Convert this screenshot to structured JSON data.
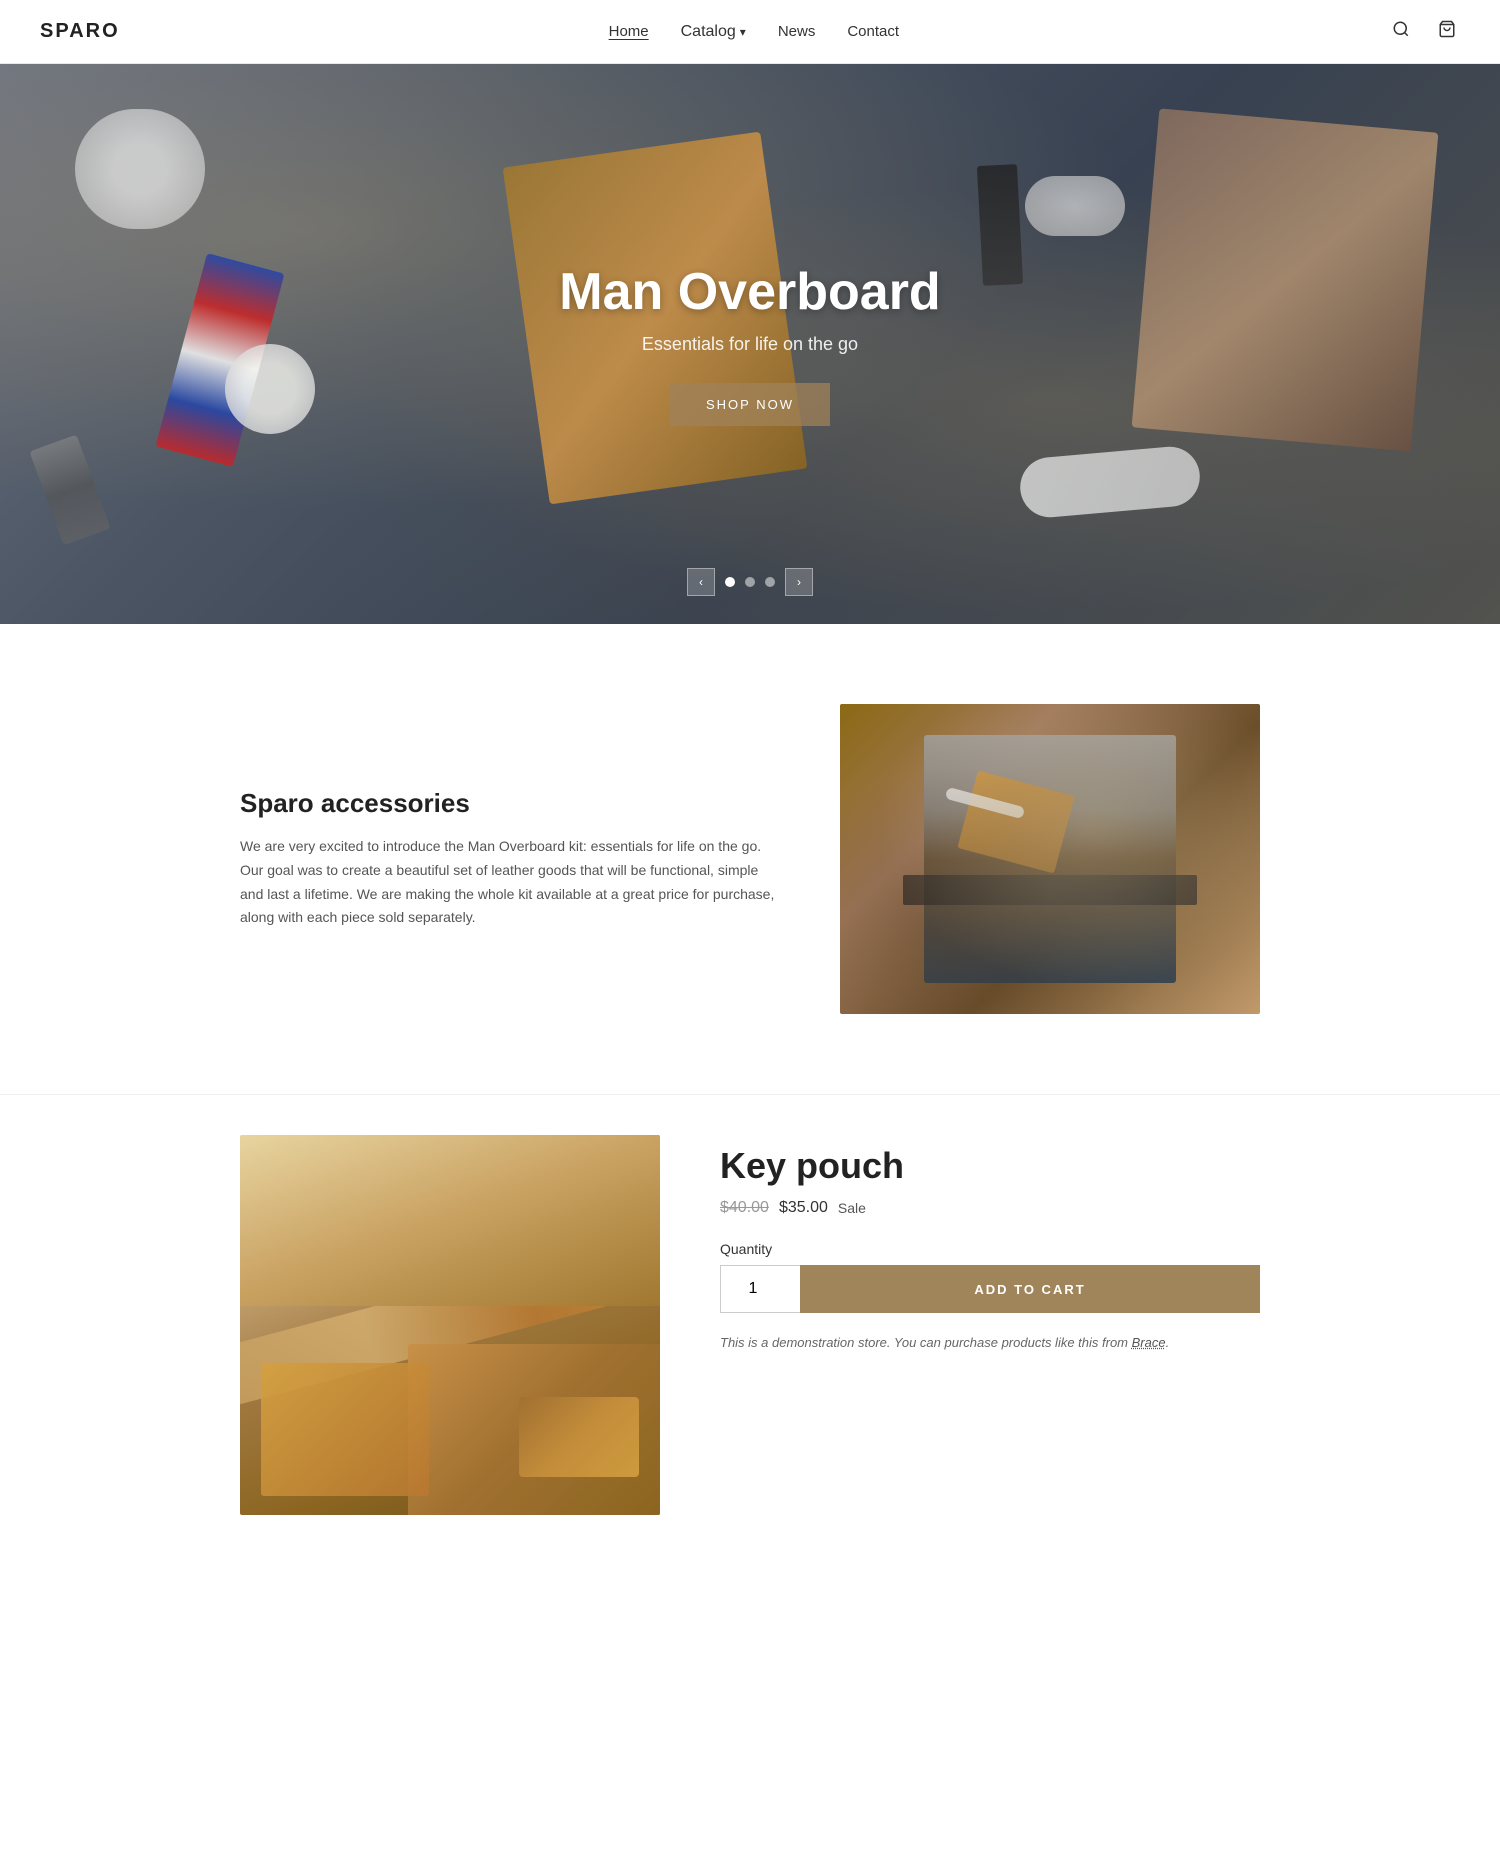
{
  "site": {
    "logo": "SPARO"
  },
  "nav": {
    "home_label": "Home",
    "catalog_label": "Catalog",
    "catalog_arrow": "▾",
    "news_label": "News",
    "contact_label": "Contact"
  },
  "hero": {
    "title": "Man Overboard",
    "subtitle": "Essentials for life on the go",
    "cta_label": "SHOP NOW",
    "prev_arrow": "‹",
    "next_arrow": "›"
  },
  "accessories": {
    "heading": "Sparo accessories",
    "body": "We are very excited to introduce the Man Overboard kit: essentials for life on the go. Our goal was to create a beautiful set of leather goods that will be functional, simple and last a lifetime. We are making the whole kit available at a great price for purchase, along with each piece sold separately."
  },
  "product": {
    "title": "Key pouch",
    "price_original": "$40.00",
    "price_sale": "$35.00",
    "price_badge": "Sale",
    "quantity_label": "Quantity",
    "quantity_value": "1",
    "add_to_cart_label": "ADD TO CART",
    "demo_text": "This is a demonstration store. You can purchase products like this from",
    "demo_link_label": "Brace",
    "demo_period": "."
  }
}
